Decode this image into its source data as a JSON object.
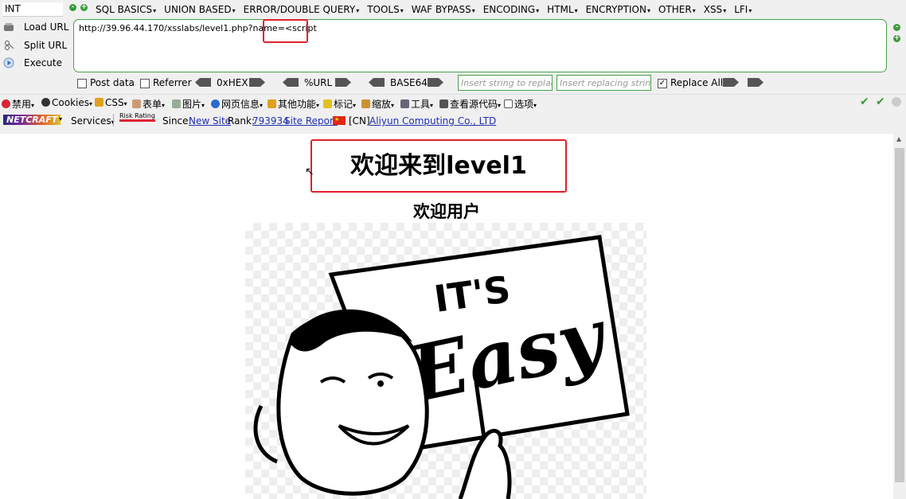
{
  "hackbar": {
    "select_value": "INT",
    "menus": [
      "SQL BASICS",
      "UNION BASED",
      "ERROR/DOUBLE QUERY",
      "TOOLS",
      "WAF BYPASS",
      "ENCODING",
      "HTML",
      "ENCRYPTION",
      "OTHER",
      "XSS",
      "LFI"
    ],
    "commands": {
      "load": "Load URL",
      "split": "Split URL",
      "execute": "Execute"
    },
    "url": "http://39.96.44.170/xsslabs/level1.php?name=<script",
    "options": {
      "post_data": "Post data",
      "referrer": "Referrer",
      "hex": "0xHEX",
      "url_enc": "%URL",
      "base64": "BASE64",
      "replace_placeholder": "Insert string to replace",
      "replacing_placeholder": "Insert replacing string",
      "replace_all": "Replace All"
    }
  },
  "toolbar": {
    "items": [
      "禁用",
      "Cookies",
      "CSS",
      "表单",
      "图片",
      "网页信息",
      "其他功能",
      "标记",
      "缩放",
      "工具",
      "查看源代码",
      "选项"
    ]
  },
  "netcraft": {
    "logo": "NETCRAFT",
    "services": "Services",
    "risk": "Risk Rating",
    "since_label": "Since:",
    "since_value": "New Site",
    "rank_label": "Rank:",
    "rank_value": "793934",
    "site_report": "Site Report",
    "country": "[CN]",
    "host": "Aliyun Computing Co., LTD"
  },
  "page": {
    "heading": "欢迎来到level1",
    "subheading": "欢迎用户",
    "image_caption_top": "IT'S",
    "image_caption_bottom": "Easy"
  },
  "colors": {
    "highlight": "#e0202a",
    "hackbar_border": "#4aa04a",
    "link": "#2030b0"
  }
}
